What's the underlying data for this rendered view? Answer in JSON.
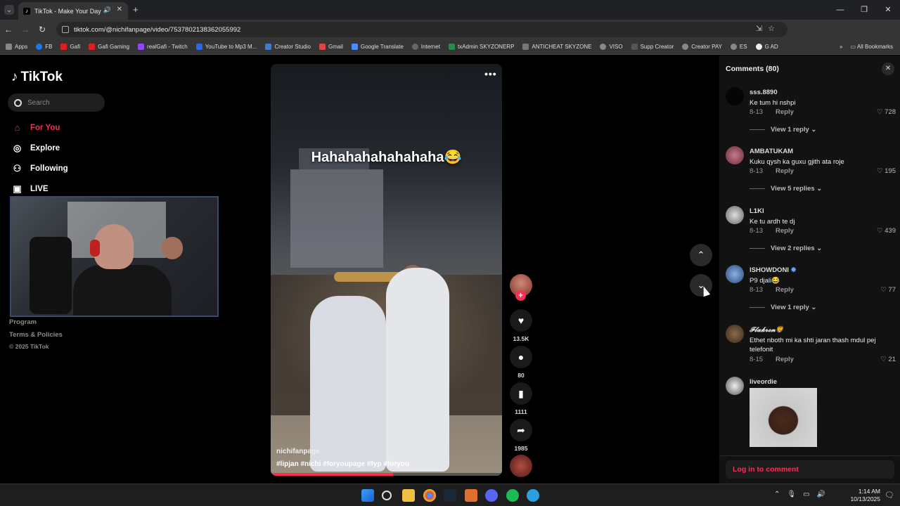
{
  "browser": {
    "tab_title": "TikTok - Make Your Day",
    "url": "tiktok.com/@nichifanpage/video/7537802138362055992",
    "bookmarks": [
      "Apps",
      "FB",
      "Gafi",
      "Gafi Gaming",
      "realGafi - Twitch",
      "YouTube to Mp3 M...",
      "Creator Studio",
      "Gmail",
      "Google Translate",
      "Internet",
      "txAdmin SKYZONERP",
      "ANTICHEAT SKYZONE",
      "VISO",
      "Supp Creator",
      "Creator PAY",
      "ES",
      "G AD"
    ],
    "all_bookmarks": "All Bookmarks"
  },
  "sidebar": {
    "brand": "TikTok",
    "search_placeholder": "Search",
    "nav": [
      {
        "label": "For You",
        "icon": "home-icon"
      },
      {
        "label": "Explore",
        "icon": "compass-icon"
      },
      {
        "label": "Following",
        "icon": "user-icon"
      },
      {
        "label": "LIVE",
        "icon": "live-tv-icon"
      }
    ],
    "footer": {
      "program": "Program",
      "terms": "Terms & Policies",
      "copyright": "© 2025 TikTok"
    }
  },
  "video": {
    "caption": "Hahahahahahahaha😂",
    "author": "nichifanpage",
    "hashtags": "#lipjan  #nichi  #foryoupage  #fyp  #foryou",
    "progress": 0.53
  },
  "actions": {
    "likes": "13.5K",
    "comments": "80",
    "saves": "1111",
    "shares": "1985"
  },
  "comments": {
    "title": "Comments (80)",
    "login": "Log in to comment",
    "reply_label": "Reply",
    "items": [
      {
        "user": "sss.8890",
        "text": "Ke tum hi nshpi",
        "date": "8-13",
        "likes": "728",
        "view": "View 1 reply"
      },
      {
        "user": "AMBATUKAM",
        "text": "Kuku qysh ka guxu gjith ata roje",
        "date": "8-13",
        "likes": "195",
        "view": "View 5 replies"
      },
      {
        "user": "L1KI",
        "text": "Ke tu ardh te dj",
        "date": "8-13",
        "likes": "439",
        "view": "View 2 replies"
      },
      {
        "user": "ISHOWDONI",
        "text": "P9 djali😂",
        "date": "8-13",
        "likes": "77",
        "view": "View 1 reply"
      },
      {
        "user": "𝓕𝓵𝓪𝓴𝓻𝓸𝓷🦁",
        "text": "Ethet nboth mi ka shti jaran thash mdul pej telefonit",
        "date": "8-15",
        "likes": "21"
      },
      {
        "user": "liveordie"
      }
    ]
  },
  "taskbar": {
    "time": "1:14 AM",
    "date": "10/13/2025"
  },
  "colors": {
    "accent": "#fe2c55",
    "bg": "#000000",
    "panel": "#121212"
  }
}
